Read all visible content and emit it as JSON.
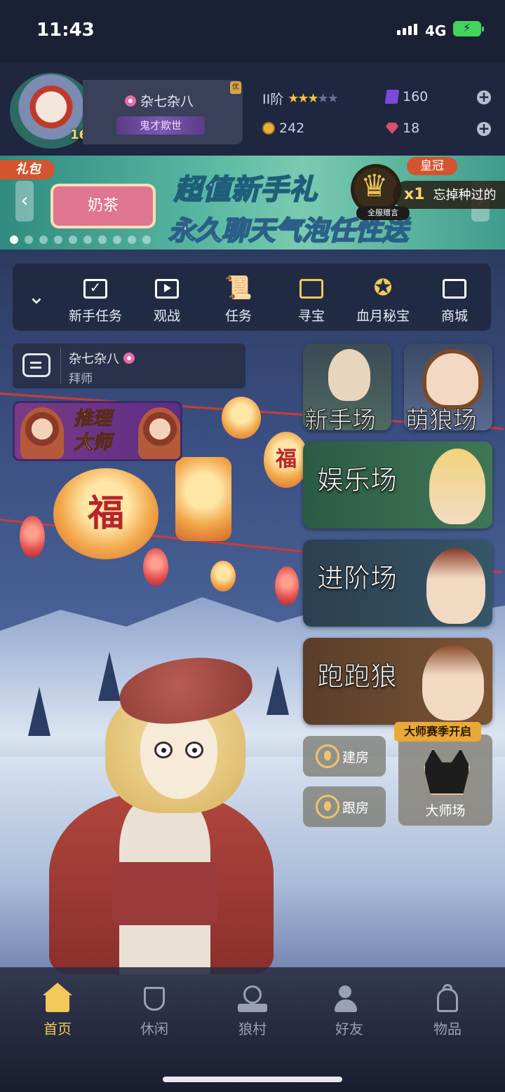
{
  "status_bar": {
    "time": "11:43",
    "network": "4G"
  },
  "profile": {
    "level": "16",
    "name": "杂七杂八",
    "title": "鬼才欺世",
    "badge": "优",
    "rank_label": "II阶",
    "stars_filled": 3,
    "stars_total": 5,
    "purple_gems": "160",
    "coins": "242",
    "red_gems": "18"
  },
  "banner": {
    "tag": "礼包",
    "bubble_text": "奶茶",
    "headline": "超值新手礼",
    "subline": "永久聊天气泡任性送",
    "crown_tag": "皇冠",
    "crown_gift": "全服赠言",
    "ribbon_count": "x1",
    "ribbon_text": "忘掉种过的",
    "dots_total": 10,
    "dot_active": 0
  },
  "menu": {
    "items": [
      {
        "label": "新手任务",
        "icon": "calendar-check-icon"
      },
      {
        "label": "观战",
        "icon": "tv-icon"
      },
      {
        "label": "任务",
        "icon": "scroll-icon"
      },
      {
        "label": "寻宝",
        "icon": "treasure-map-icon"
      },
      {
        "label": "血月秘宝",
        "icon": "moon-compass-icon"
      },
      {
        "label": "商城",
        "icon": "shop-icon"
      }
    ]
  },
  "master_chat": {
    "name": "杂七杂八",
    "subtitle": "拜师"
  },
  "master_badge": {
    "line1": "推理",
    "line2": "大师"
  },
  "lantern_text": "福",
  "modes": {
    "novice": "新手场",
    "cute": "萌狼场",
    "fun": "娱乐场",
    "advanced": "进阶场",
    "run": "跑跑狼"
  },
  "room": {
    "create": "建房",
    "follow": "跟房"
  },
  "master_mode": {
    "label": "大师场",
    "tag": "大师赛季开启"
  },
  "tabs": [
    {
      "label": "首页",
      "active": true
    },
    {
      "label": "休闲",
      "active": false
    },
    {
      "label": "狼村",
      "active": false
    },
    {
      "label": "好友",
      "active": false
    },
    {
      "label": "物品",
      "active": false
    }
  ],
  "colors": {
    "accent_gold": "#f2c85a",
    "banner_teal": "#58b7a1",
    "tag_red": "#d3542f"
  }
}
